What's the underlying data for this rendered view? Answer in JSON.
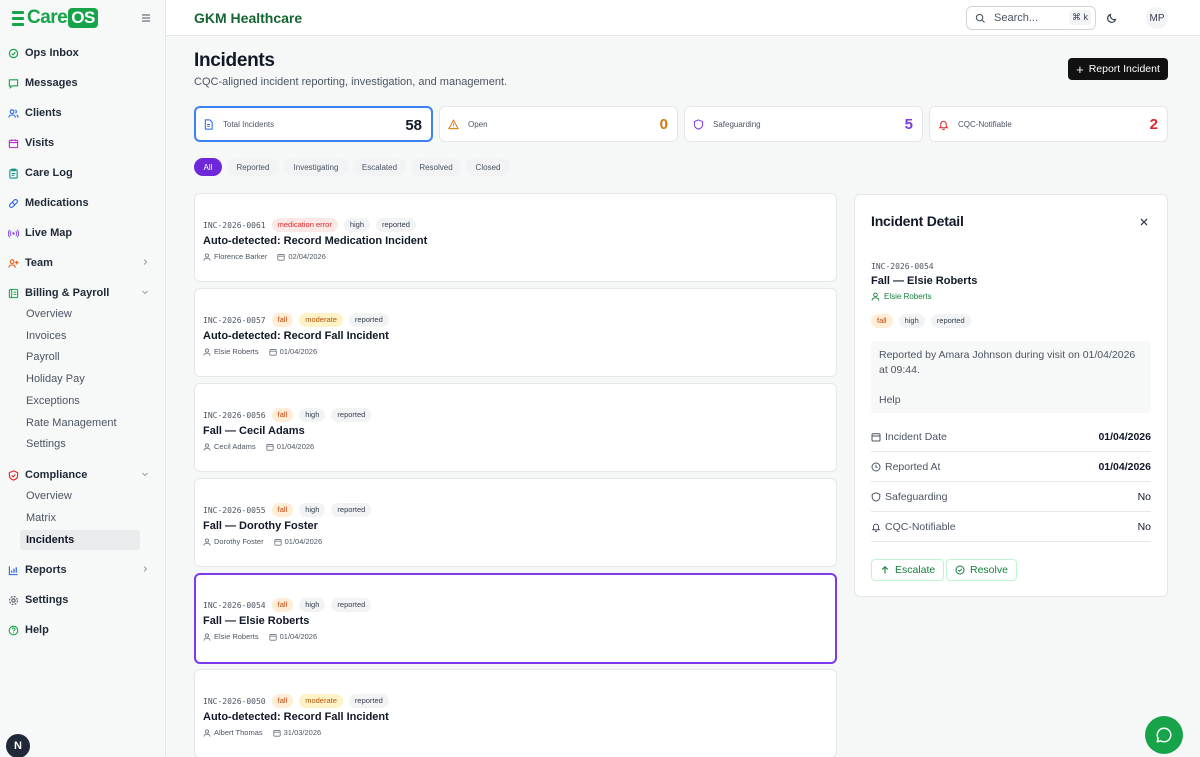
{
  "brand": {
    "logo_care": "Care",
    "logo_os": "OS"
  },
  "sidebar": {
    "items": [
      {
        "label": "Ops Inbox"
      },
      {
        "label": "Messages"
      },
      {
        "label": "Clients"
      },
      {
        "label": "Visits"
      },
      {
        "label": "Care Log"
      },
      {
        "label": "Medications"
      },
      {
        "label": "Live Map"
      },
      {
        "label": "Team"
      },
      {
        "label": "Billing & Payroll"
      },
      {
        "label": "Compliance"
      },
      {
        "label": "Reports"
      },
      {
        "label": "Settings"
      },
      {
        "label": "Help"
      }
    ],
    "billing_sub": [
      "Overview",
      "Invoices",
      "Payroll",
      "Holiday Pay",
      "Exceptions",
      "Rate Management",
      "Settings"
    ],
    "compliance_sub": [
      "Overview",
      "Matrix",
      "Incidents"
    ],
    "badge": "N"
  },
  "header": {
    "org": "GKM Healthcare",
    "search_placeholder": "Search...",
    "shortcut": "⌘ k",
    "avatar": "MP"
  },
  "page": {
    "title": "Incidents",
    "subtitle": "CQC-aligned incident reporting, investigation, and management.",
    "report_button": "Report Incident"
  },
  "stats": [
    {
      "label": "Total Incidents",
      "value": "58",
      "color": "#111827"
    },
    {
      "label": "Open",
      "value": "0",
      "color": "#d97706"
    },
    {
      "label": "Safeguarding",
      "value": "5",
      "color": "#7c3aed"
    },
    {
      "label": "CQC-Notifiable",
      "value": "2",
      "color": "#dc2626"
    }
  ],
  "filters": [
    "All",
    "Reported",
    "Investigating",
    "Escalated",
    "Resolved",
    "Closed"
  ],
  "incidents": [
    {
      "code": "INC-2026-0061",
      "type": "medication error",
      "severity": "high",
      "status": "reported",
      "title": "Auto-detected: Record Medication Incident",
      "client": "Florence Barker",
      "date": "02/04/2026"
    },
    {
      "code": "INC-2026-0057",
      "type": "fall",
      "severity": "moderate",
      "status": "reported",
      "title": "Auto-detected: Record Fall Incident",
      "client": "Elsie Roberts",
      "date": "01/04/2026"
    },
    {
      "code": "INC-2026-0056",
      "type": "fall",
      "severity": "high",
      "status": "reported",
      "title": "Fall — Cecil Adams",
      "client": "Cecil Adams",
      "date": "01/04/2026"
    },
    {
      "code": "INC-2026-0055",
      "type": "fall",
      "severity": "high",
      "status": "reported",
      "title": "Fall — Dorothy Foster",
      "client": "Dorothy Foster",
      "date": "01/04/2026"
    },
    {
      "code": "INC-2026-0054",
      "type": "fall",
      "severity": "high",
      "status": "reported",
      "title": "Fall — Elsie Roberts",
      "client": "Elsie Roberts",
      "date": "01/04/2026"
    },
    {
      "code": "INC-2026-0050",
      "type": "fall",
      "severity": "moderate",
      "status": "reported",
      "title": "Auto-detected: Record Fall Incident",
      "client": "Albert Thomas",
      "date": "31/03/2026"
    }
  ],
  "detail": {
    "heading": "Incident Detail",
    "code": "INC-2026-0054",
    "title": "Fall — Elsie Roberts",
    "client": "Elsie Roberts",
    "tags": [
      "fall",
      "high",
      "reported"
    ],
    "note": "Reported by Amara Johnson during visit on 01/04/2026 at 09:44.",
    "note_extra": "Help",
    "fields": [
      {
        "label": "Incident Date",
        "value": "01/04/2026"
      },
      {
        "label": "Reported At",
        "value": "01/04/2026"
      },
      {
        "label": "Safeguarding",
        "value": "No"
      },
      {
        "label": "CQC-Notifiable",
        "value": "No"
      }
    ],
    "escalate": "Escalate",
    "resolve": "Resolve"
  }
}
